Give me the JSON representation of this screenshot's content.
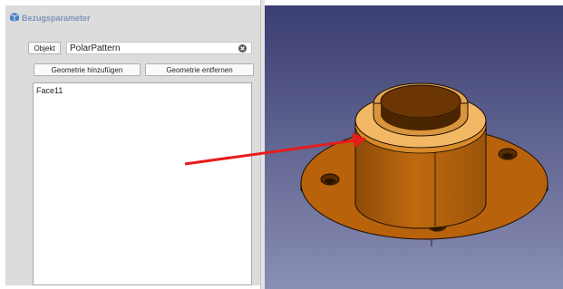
{
  "panel": {
    "title": "Bezugsparameter",
    "icon": "datum-parameters-icon",
    "object_button_label": "Objekt",
    "object_field_value": "PolarPattern",
    "add_geometry_label": "Geometrie hinzufügen",
    "remove_geometry_label": "Geometrie entfernen",
    "list_items": [
      "Face11"
    ]
  },
  "viewport": {
    "model": "flange-part",
    "background_top": "#3a3d70",
    "background_bottom": "#8a8fb4",
    "part_color": "#b8620c"
  },
  "annotation": {
    "arrow_color": "#e81b1b"
  }
}
